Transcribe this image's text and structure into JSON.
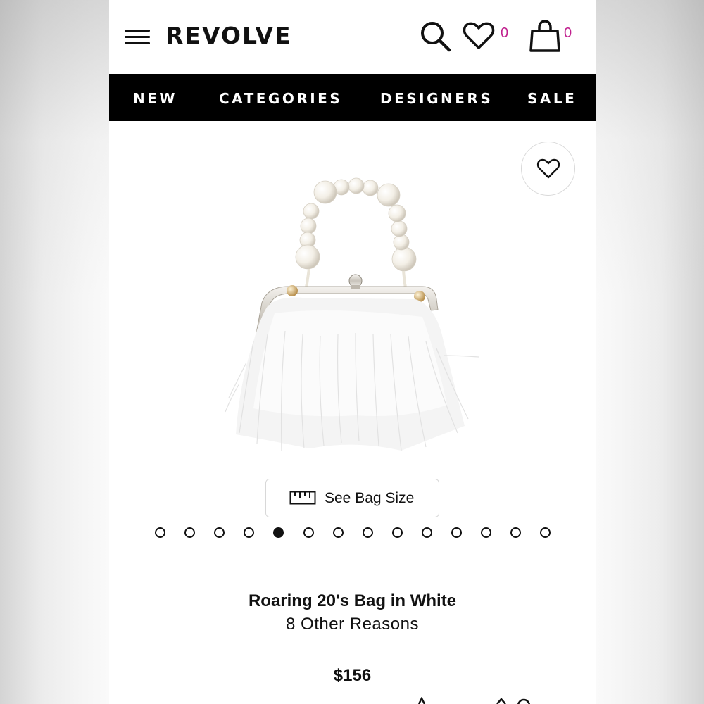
{
  "header": {
    "logo": "REVOLVE",
    "wishlist_count": "0",
    "bag_count": "0",
    "icons": [
      "menu-icon",
      "search-icon",
      "heart-icon",
      "shopping-bag-icon"
    ]
  },
  "nav": {
    "items": [
      {
        "label": "NEW"
      },
      {
        "label": "CATEGORIES"
      },
      {
        "label": "DESIGNERS"
      },
      {
        "label": "SALE"
      }
    ]
  },
  "gallery": {
    "size_button_label": "See Bag Size",
    "dot_count": 14,
    "active_dot_index": 4
  },
  "product": {
    "name": "Roaring 20's Bag in White",
    "brand": "8 Other Reasons",
    "price": "$156"
  },
  "colors": {
    "nav_background": "#000000",
    "count_accent": "#c0208e",
    "text": "#111111"
  }
}
